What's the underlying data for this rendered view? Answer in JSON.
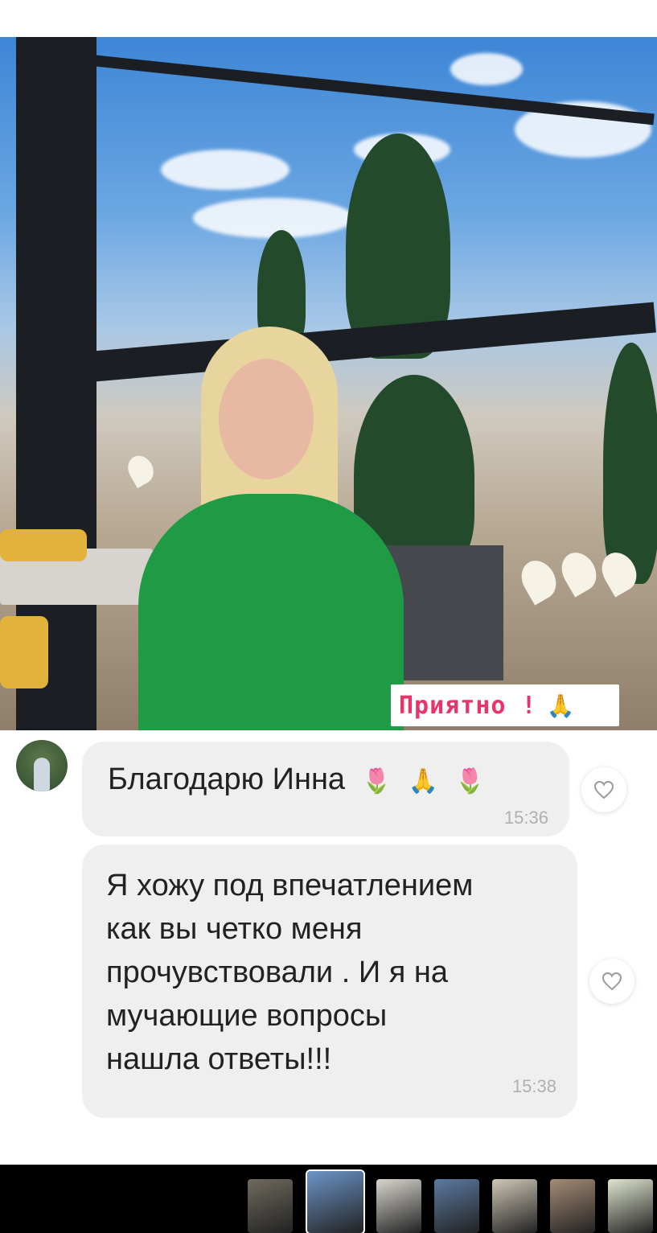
{
  "story": {
    "sticker_text": "Приятно !",
    "sticker_emoji": "🙏"
  },
  "messages": [
    {
      "text": "Благодарю Инна",
      "emojis": [
        "🌷",
        "🙏",
        "🌷"
      ],
      "time": "15:36"
    },
    {
      "text_lines": [
        "Я хожу под впечатлением",
        "как вы четко меня",
        "прочувствовали . И я на",
        "мучающие вопросы",
        "нашла ответы!!!"
      ],
      "time": "15:38"
    }
  ],
  "thumbnails": [
    {
      "color": "#6f6a5f"
    },
    {
      "color": "#6c95c8",
      "active": true
    },
    {
      "color": "#d9d6cf"
    },
    {
      "color": "#5b7aa0"
    },
    {
      "color": "#cfc7b7"
    },
    {
      "color": "#a58c75"
    },
    {
      "color": "#dfe6cf"
    }
  ],
  "colors": {
    "bubble": "#efefef",
    "sticker_text": "#e8346a",
    "timestamp": "#b0b0b0"
  }
}
